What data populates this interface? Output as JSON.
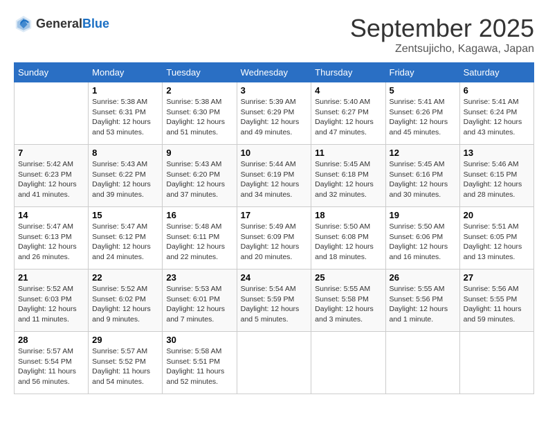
{
  "header": {
    "logo_general": "General",
    "logo_blue": "Blue",
    "month": "September 2025",
    "location": "Zentsujicho, Kagawa, Japan"
  },
  "weekdays": [
    "Sunday",
    "Monday",
    "Tuesday",
    "Wednesday",
    "Thursday",
    "Friday",
    "Saturday"
  ],
  "weeks": [
    [
      {
        "day": "",
        "sunrise": "",
        "sunset": "",
        "daylight": ""
      },
      {
        "day": "1",
        "sunrise": "Sunrise: 5:38 AM",
        "sunset": "Sunset: 6:31 PM",
        "daylight": "Daylight: 12 hours and 53 minutes."
      },
      {
        "day": "2",
        "sunrise": "Sunrise: 5:38 AM",
        "sunset": "Sunset: 6:30 PM",
        "daylight": "Daylight: 12 hours and 51 minutes."
      },
      {
        "day": "3",
        "sunrise": "Sunrise: 5:39 AM",
        "sunset": "Sunset: 6:29 PM",
        "daylight": "Daylight: 12 hours and 49 minutes."
      },
      {
        "day": "4",
        "sunrise": "Sunrise: 5:40 AM",
        "sunset": "Sunset: 6:27 PM",
        "daylight": "Daylight: 12 hours and 47 minutes."
      },
      {
        "day": "5",
        "sunrise": "Sunrise: 5:41 AM",
        "sunset": "Sunset: 6:26 PM",
        "daylight": "Daylight: 12 hours and 45 minutes."
      },
      {
        "day": "6",
        "sunrise": "Sunrise: 5:41 AM",
        "sunset": "Sunset: 6:24 PM",
        "daylight": "Daylight: 12 hours and 43 minutes."
      }
    ],
    [
      {
        "day": "7",
        "sunrise": "Sunrise: 5:42 AM",
        "sunset": "Sunset: 6:23 PM",
        "daylight": "Daylight: 12 hours and 41 minutes."
      },
      {
        "day": "8",
        "sunrise": "Sunrise: 5:43 AM",
        "sunset": "Sunset: 6:22 PM",
        "daylight": "Daylight: 12 hours and 39 minutes."
      },
      {
        "day": "9",
        "sunrise": "Sunrise: 5:43 AM",
        "sunset": "Sunset: 6:20 PM",
        "daylight": "Daylight: 12 hours and 37 minutes."
      },
      {
        "day": "10",
        "sunrise": "Sunrise: 5:44 AM",
        "sunset": "Sunset: 6:19 PM",
        "daylight": "Daylight: 12 hours and 34 minutes."
      },
      {
        "day": "11",
        "sunrise": "Sunrise: 5:45 AM",
        "sunset": "Sunset: 6:18 PM",
        "daylight": "Daylight: 12 hours and 32 minutes."
      },
      {
        "day": "12",
        "sunrise": "Sunrise: 5:45 AM",
        "sunset": "Sunset: 6:16 PM",
        "daylight": "Daylight: 12 hours and 30 minutes."
      },
      {
        "day": "13",
        "sunrise": "Sunrise: 5:46 AM",
        "sunset": "Sunset: 6:15 PM",
        "daylight": "Daylight: 12 hours and 28 minutes."
      }
    ],
    [
      {
        "day": "14",
        "sunrise": "Sunrise: 5:47 AM",
        "sunset": "Sunset: 6:13 PM",
        "daylight": "Daylight: 12 hours and 26 minutes."
      },
      {
        "day": "15",
        "sunrise": "Sunrise: 5:47 AM",
        "sunset": "Sunset: 6:12 PM",
        "daylight": "Daylight: 12 hours and 24 minutes."
      },
      {
        "day": "16",
        "sunrise": "Sunrise: 5:48 AM",
        "sunset": "Sunset: 6:11 PM",
        "daylight": "Daylight: 12 hours and 22 minutes."
      },
      {
        "day": "17",
        "sunrise": "Sunrise: 5:49 AM",
        "sunset": "Sunset: 6:09 PM",
        "daylight": "Daylight: 12 hours and 20 minutes."
      },
      {
        "day": "18",
        "sunrise": "Sunrise: 5:50 AM",
        "sunset": "Sunset: 6:08 PM",
        "daylight": "Daylight: 12 hours and 18 minutes."
      },
      {
        "day": "19",
        "sunrise": "Sunrise: 5:50 AM",
        "sunset": "Sunset: 6:06 PM",
        "daylight": "Daylight: 12 hours and 16 minutes."
      },
      {
        "day": "20",
        "sunrise": "Sunrise: 5:51 AM",
        "sunset": "Sunset: 6:05 PM",
        "daylight": "Daylight: 12 hours and 13 minutes."
      }
    ],
    [
      {
        "day": "21",
        "sunrise": "Sunrise: 5:52 AM",
        "sunset": "Sunset: 6:03 PM",
        "daylight": "Daylight: 12 hours and 11 minutes."
      },
      {
        "day": "22",
        "sunrise": "Sunrise: 5:52 AM",
        "sunset": "Sunset: 6:02 PM",
        "daylight": "Daylight: 12 hours and 9 minutes."
      },
      {
        "day": "23",
        "sunrise": "Sunrise: 5:53 AM",
        "sunset": "Sunset: 6:01 PM",
        "daylight": "Daylight: 12 hours and 7 minutes."
      },
      {
        "day": "24",
        "sunrise": "Sunrise: 5:54 AM",
        "sunset": "Sunset: 5:59 PM",
        "daylight": "Daylight: 12 hours and 5 minutes."
      },
      {
        "day": "25",
        "sunrise": "Sunrise: 5:55 AM",
        "sunset": "Sunset: 5:58 PM",
        "daylight": "Daylight: 12 hours and 3 minutes."
      },
      {
        "day": "26",
        "sunrise": "Sunrise: 5:55 AM",
        "sunset": "Sunset: 5:56 PM",
        "daylight": "Daylight: 12 hours and 1 minute."
      },
      {
        "day": "27",
        "sunrise": "Sunrise: 5:56 AM",
        "sunset": "Sunset: 5:55 PM",
        "daylight": "Daylight: 11 hours and 59 minutes."
      }
    ],
    [
      {
        "day": "28",
        "sunrise": "Sunrise: 5:57 AM",
        "sunset": "Sunset: 5:54 PM",
        "daylight": "Daylight: 11 hours and 56 minutes."
      },
      {
        "day": "29",
        "sunrise": "Sunrise: 5:57 AM",
        "sunset": "Sunset: 5:52 PM",
        "daylight": "Daylight: 11 hours and 54 minutes."
      },
      {
        "day": "30",
        "sunrise": "Sunrise: 5:58 AM",
        "sunset": "Sunset: 5:51 PM",
        "daylight": "Daylight: 11 hours and 52 minutes."
      },
      {
        "day": "",
        "sunrise": "",
        "sunset": "",
        "daylight": ""
      },
      {
        "day": "",
        "sunrise": "",
        "sunset": "",
        "daylight": ""
      },
      {
        "day": "",
        "sunrise": "",
        "sunset": "",
        "daylight": ""
      },
      {
        "day": "",
        "sunrise": "",
        "sunset": "",
        "daylight": ""
      }
    ]
  ]
}
